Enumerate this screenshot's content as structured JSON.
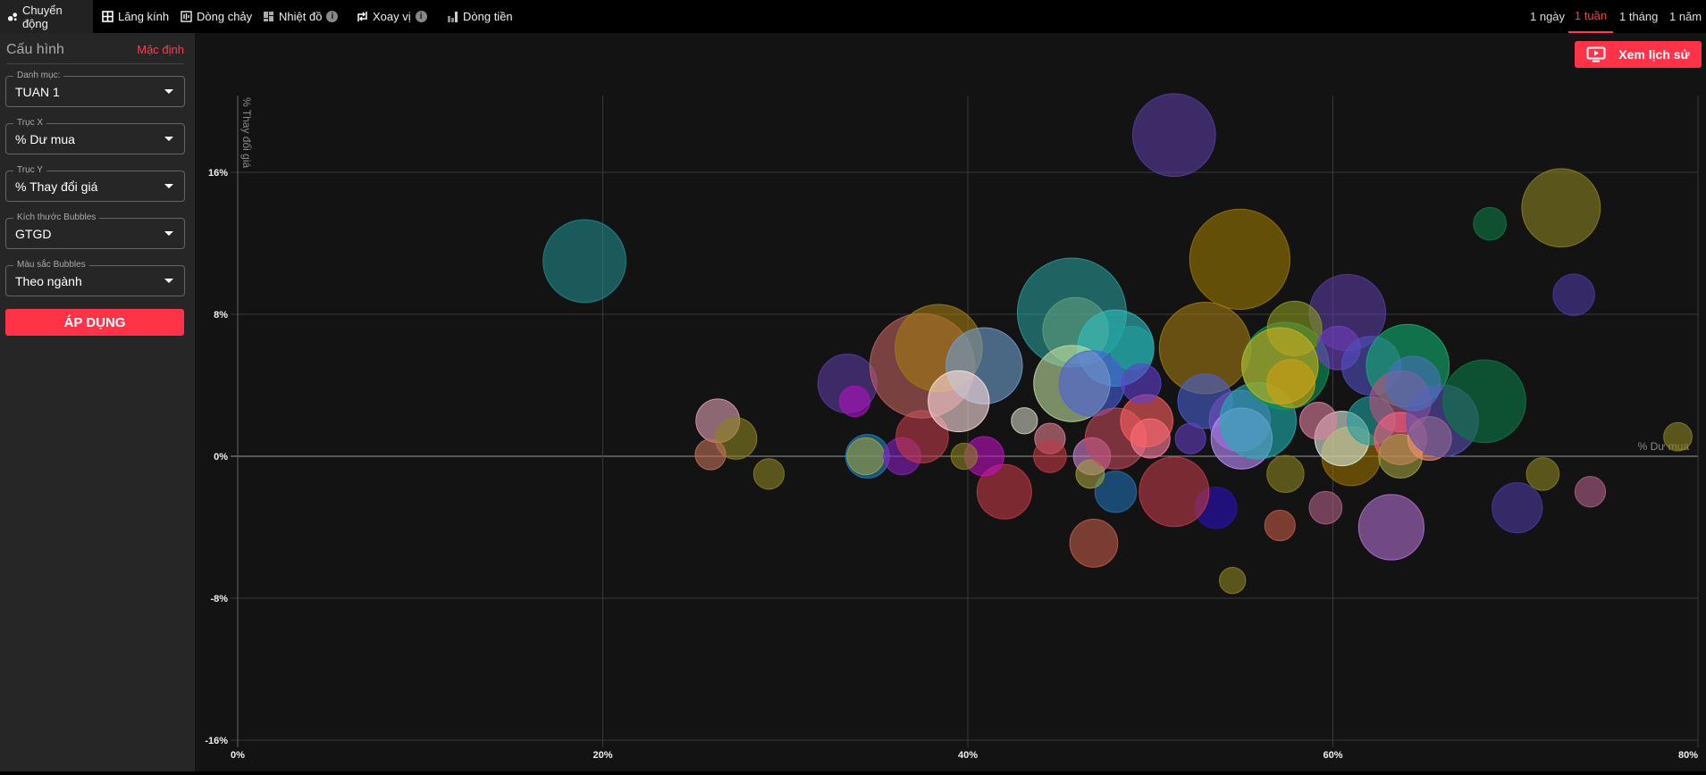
{
  "topbar": {
    "tabs": [
      {
        "label": "Chuyển động",
        "icon": "bubbles-icon"
      },
      {
        "label": "Lăng kính",
        "icon": "grid-icon"
      },
      {
        "label": "Dòng chảy",
        "icon": "flow-icon"
      },
      {
        "label": "Nhiệt đồ",
        "icon": "heatmap-icon",
        "info": "i"
      },
      {
        "label": "Xoay vị",
        "icon": "rotate-icon",
        "info": "i"
      },
      {
        "label": "Dòng tiền",
        "icon": "bar-icon"
      }
    ],
    "time_tabs": [
      "1 ngày",
      "1 tuần",
      "1 tháng",
      "1 năm"
    ],
    "active_time": "1 tuần"
  },
  "sidebar": {
    "title": "Cấu hình",
    "default_link": "Mặc định",
    "selects": [
      {
        "label": "Danh mục:",
        "value": "TUAN 1"
      },
      {
        "label": "Trục X",
        "value": "% Dư mua"
      },
      {
        "label": "Trục Y",
        "value": "% Thay đổi giá"
      },
      {
        "label": "Kích thước Bubbles",
        "value": "GTGD"
      },
      {
        "label": "Màu sắc Bubbles",
        "value": "Theo ngành"
      }
    ],
    "apply_label": "ÁP DỤNG"
  },
  "history_button": "Xem lịch sử",
  "colors": {
    "accent": "#ff3347",
    "background": "#131313",
    "sidebar": "#262626"
  },
  "chart_data": {
    "type": "scatter",
    "xlabel": "% Dư mua",
    "ylabel": "% Thay đổi giá",
    "xlim": [
      0,
      80
    ],
    "ylim": [
      -16,
      20.5
    ],
    "xticks": [
      0,
      20,
      40,
      60,
      80
    ],
    "xtick_labels": [
      "0%",
      "20%",
      "40%",
      "60%",
      "80%"
    ],
    "yticks": [
      16,
      8,
      0,
      -8,
      -16
    ],
    "ytick_labels": [
      "16%",
      "8%",
      "0%",
      "-8%",
      "-16%"
    ],
    "grid": true,
    "points": [
      {
        "x": 19.0,
        "y": 11.0,
        "size": 38,
        "color": "#1f8a8a"
      },
      {
        "x": 51.3,
        "y": 18.1,
        "size": 38,
        "color": "#5a3ca0"
      },
      {
        "x": 72.5,
        "y": 14.0,
        "size": 36,
        "color": "#8a8220"
      },
      {
        "x": 68.6,
        "y": 13.1,
        "size": 15,
        "color": "#0d7a45"
      },
      {
        "x": 73.2,
        "y": 9.1,
        "size": 19,
        "color": "#4d38a0"
      },
      {
        "x": 54.9,
        "y": 11.1,
        "size": 46,
        "color": "#9a7800"
      },
      {
        "x": 45.7,
        "y": 8.1,
        "size": 50,
        "color": "#2a9a9a"
      },
      {
        "x": 60.8,
        "y": 8.1,
        "size": 35,
        "color": "#5a3ca0"
      },
      {
        "x": 78.9,
        "y": 1.1,
        "size": 13,
        "color": "#8a8220"
      },
      {
        "x": 71.5,
        "y": -1.0,
        "size": 15,
        "color": "#8a8220"
      },
      {
        "x": 74.1,
        "y": -2.0,
        "size": 14,
        "color": "#b06088"
      },
      {
        "x": 70.1,
        "y": -2.9,
        "size": 23,
        "color": "#4d38a0"
      },
      {
        "x": 63.2,
        "y": -4.0,
        "size": 30,
        "color": "#b070d0"
      },
      {
        "x": 59.6,
        "y": -2.9,
        "size": 15,
        "color": "#b06088"
      },
      {
        "x": 57.1,
        "y": -3.9,
        "size": 14,
        "color": "#c05a45"
      },
      {
        "x": 54.5,
        "y": -7.0,
        "size": 12,
        "color": "#8a8220"
      },
      {
        "x": 53.6,
        "y": -2.9,
        "size": 19,
        "color": "#2a10c0"
      },
      {
        "x": 51.3,
        "y": -2.0,
        "size": 32,
        "color": "#c03a4a"
      },
      {
        "x": 46.9,
        "y": -4.9,
        "size": 22,
        "color": "#c05a4a"
      },
      {
        "x": 48.1,
        "y": -2.0,
        "size": 19,
        "color": "#2070b0"
      },
      {
        "x": 42.0,
        "y": -2.0,
        "size": 25,
        "color": "#c03a45"
      },
      {
        "x": 26.3,
        "y": 2.0,
        "size": 20,
        "color": "#e0a0b0"
      },
      {
        "x": 27.3,
        "y": 1.0,
        "size": 19,
        "color": "#8a8220"
      },
      {
        "x": 25.9,
        "y": 0.1,
        "size": 14,
        "color": "#c0705a"
      },
      {
        "x": 29.1,
        "y": -1.0,
        "size": 14,
        "color": "#8a8220"
      },
      {
        "x": 33.4,
        "y": 4.1,
        "size": 27,
        "color": "#5a3ca0"
      },
      {
        "x": 33.8,
        "y": 3.1,
        "size": 14,
        "color": "#b010c0"
      },
      {
        "x": 34.5,
        "y": 0.0,
        "size": 20,
        "color": "#2080c0"
      },
      {
        "x": 34.4,
        "y": 0.0,
        "size": 17,
        "color": "#a0a040"
      },
      {
        "x": 36.4,
        "y": 0.0,
        "size": 17,
        "color": "#8a20c0"
      },
      {
        "x": 37.5,
        "y": 1.1,
        "size": 24,
        "color": "#c03a4a"
      },
      {
        "x": 37.5,
        "y": 5.1,
        "size": 48,
        "color": "#c06060"
      },
      {
        "x": 38.4,
        "y": 6.1,
        "size": 40,
        "color": "#a07a10"
      },
      {
        "x": 40.9,
        "y": 5.1,
        "size": 35,
        "color": "#70a0d0"
      },
      {
        "x": 39.5,
        "y": 3.1,
        "size": 28,
        "color": "#ffe0e0"
      },
      {
        "x": 40.9,
        "y": 0.0,
        "size": 18,
        "color": "#c010c0"
      },
      {
        "x": 39.8,
        "y": 0.0,
        "size": 12,
        "color": "#8a8220"
      },
      {
        "x": 43.1,
        "y": 2.0,
        "size": 12,
        "color": "#d0d0c0"
      },
      {
        "x": 44.5,
        "y": 1.0,
        "size": 14,
        "color": "#e08090"
      },
      {
        "x": 44.5,
        "y": 0.0,
        "size": 15,
        "color": "#c03a45"
      },
      {
        "x": 46.8,
        "y": 0.0,
        "size": 17,
        "color": "#d080d0"
      },
      {
        "x": 46.7,
        "y": -1.0,
        "size": 13,
        "color": "#a0a040"
      },
      {
        "x": 45.9,
        "y": 7.1,
        "size": 30,
        "color": "#60a080"
      },
      {
        "x": 48.1,
        "y": 6.1,
        "size": 35,
        "color": "#30c0c0"
      },
      {
        "x": 49.0,
        "y": 6.1,
        "size": 20,
        "color": "#20a0a0"
      },
      {
        "x": 45.7,
        "y": 4.1,
        "size": 35,
        "color": "#c0e0a0"
      },
      {
        "x": 46.8,
        "y": 4.1,
        "size": 30,
        "color": "#4a60e0"
      },
      {
        "x": 48.1,
        "y": 1.0,
        "size": 28,
        "color": "#c04a5a"
      },
      {
        "x": 50.0,
        "y": 1.0,
        "size": 18,
        "color": "#ff80a0"
      },
      {
        "x": 49.8,
        "y": 2.0,
        "size": 24,
        "color": "#ff6060"
      },
      {
        "x": 53.0,
        "y": 6.1,
        "size": 42,
        "color": "#a07a10"
      },
      {
        "x": 53.0,
        "y": 3.1,
        "size": 25,
        "color": "#4a60d0"
      },
      {
        "x": 54.9,
        "y": 2.0,
        "size": 28,
        "color": "#7050c0"
      },
      {
        "x": 55.0,
        "y": 1.0,
        "size": 28,
        "color": "#c090ff"
      },
      {
        "x": 55.9,
        "y": 2.0,
        "size": 35,
        "color": "#20b0b0"
      },
      {
        "x": 57.4,
        "y": 5.1,
        "size": 40,
        "color": "#0a9a5a"
      },
      {
        "x": 57.9,
        "y": 7.2,
        "size": 25,
        "color": "#8a9a20"
      },
      {
        "x": 57.1,
        "y": 5.1,
        "size": 35,
        "color": "#d0b020"
      },
      {
        "x": 57.7,
        "y": 4.1,
        "size": 22,
        "color": "#d0a010"
      },
      {
        "x": 57.4,
        "y": -1.0,
        "size": 17,
        "color": "#8a8220"
      },
      {
        "x": 60.3,
        "y": 6.1,
        "size": 20,
        "color": "#7040c0"
      },
      {
        "x": 61.0,
        "y": 0.0,
        "size": 27,
        "color": "#9a7000"
      },
      {
        "x": 60.5,
        "y": 1.0,
        "size": 25,
        "color": "#e0f0e0"
      },
      {
        "x": 62.1,
        "y": 2.0,
        "size": 22,
        "color": "#20a0a0"
      },
      {
        "x": 62.1,
        "y": 5.1,
        "size": 27,
        "color": "#5050c0"
      },
      {
        "x": 64.1,
        "y": 5.1,
        "size": 38,
        "color": "#10b070"
      },
      {
        "x": 63.7,
        "y": 3.1,
        "size": 28,
        "color": "#c05080"
      },
      {
        "x": 63.7,
        "y": 1.0,
        "size": 24,
        "color": "#ff6080"
      },
      {
        "x": 63.7,
        "y": 0.0,
        "size": 20,
        "color": "#a0a040"
      },
      {
        "x": 65.3,
        "y": 1.0,
        "size": 20,
        "color": "#f09070"
      },
      {
        "x": 66.0,
        "y": 2.0,
        "size": 33,
        "color": "#5a50b0"
      },
      {
        "x": 68.3,
        "y": 3.1,
        "size": 38,
        "color": "#0a7a48"
      },
      {
        "x": 64.4,
        "y": 4.1,
        "size": 25,
        "color": "#4a70c0"
      },
      {
        "x": 59.2,
        "y": 2.0,
        "size": 17,
        "color": "#e080a0"
      },
      {
        "x": 52.2,
        "y": 1.0,
        "size": 14,
        "color": "#6040c0"
      },
      {
        "x": 49.5,
        "y": 4.1,
        "size": 18,
        "color": "#6040d0"
      }
    ]
  }
}
